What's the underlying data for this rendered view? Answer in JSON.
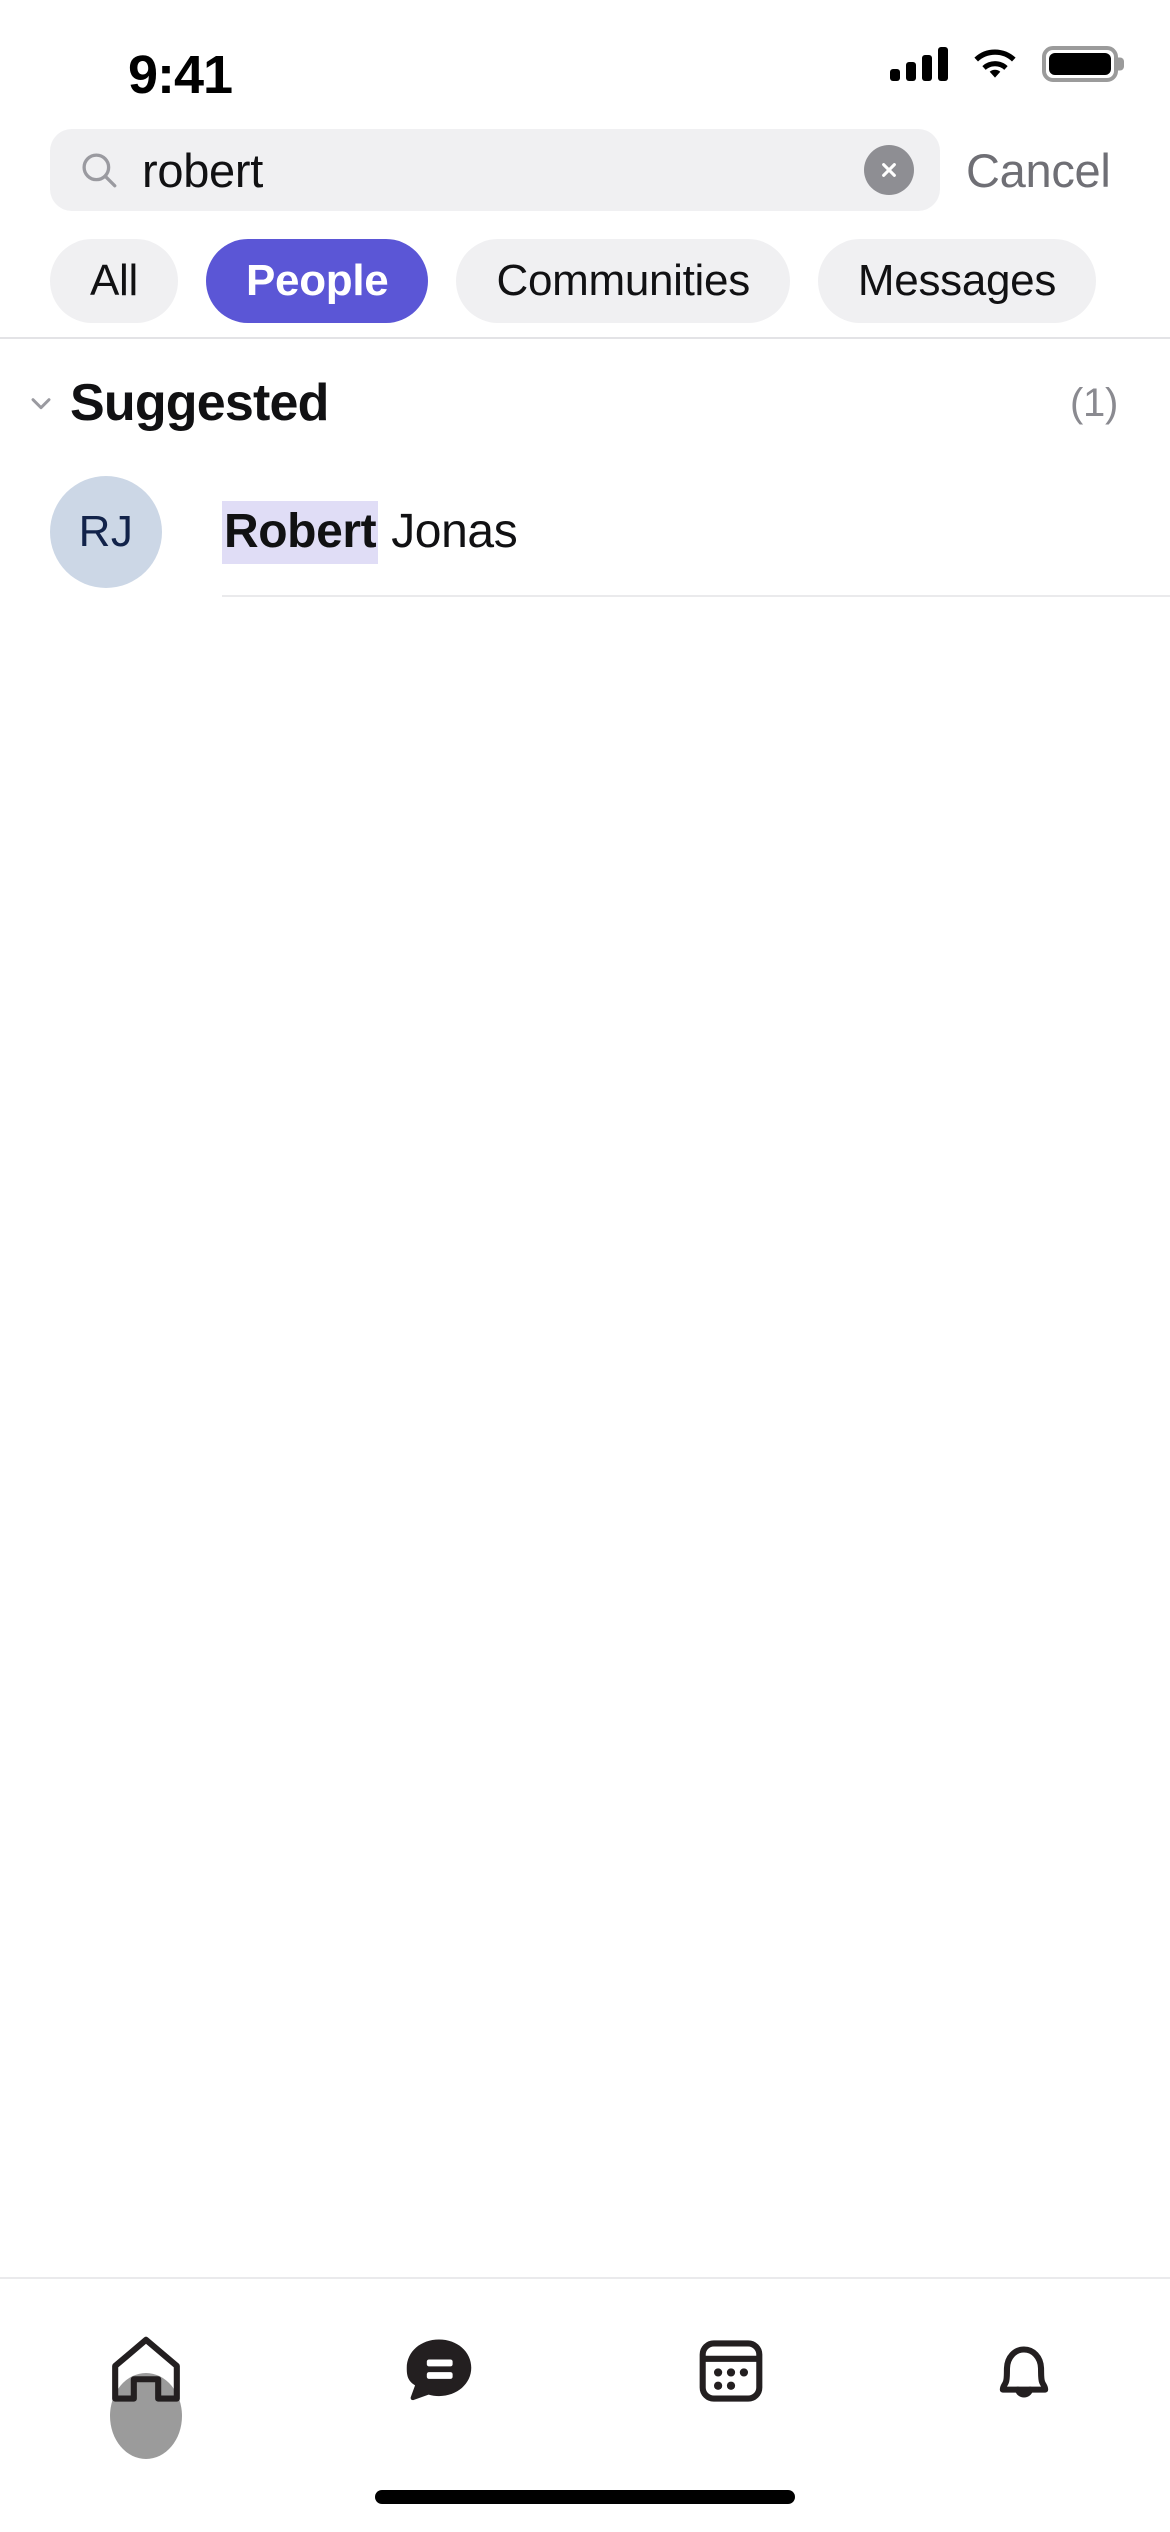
{
  "status_bar": {
    "time": "9:41",
    "cellular_icon": "cellular-signal-icon",
    "wifi_icon": "wifi-icon",
    "battery_icon": "battery-full-icon"
  },
  "search": {
    "icon": "search-icon",
    "value": "robert",
    "placeholder": "Search",
    "clear_icon": "clear-circle-icon",
    "cancel_label": "Cancel"
  },
  "filters": {
    "chips": [
      {
        "label": "All",
        "selected": false
      },
      {
        "label": "People",
        "selected": true
      },
      {
        "label": "Communities",
        "selected": false
      },
      {
        "label": "Messages",
        "selected": false
      }
    ],
    "selected_color": "#5b56d6",
    "unselected_color": "#f0f0f2"
  },
  "results": {
    "section": {
      "title": "Suggested",
      "count": "(1)",
      "collapse_icon": "chevron-down-icon"
    },
    "items": [
      {
        "initials": "RJ",
        "name_match": "Robert",
        "name_rest": " Jonas",
        "avatar_bg": "#ccd7e6",
        "avatar_fg": "#12234a",
        "highlight_bg": "#e0ddf6"
      }
    ]
  },
  "tab_bar": {
    "tabs": [
      {
        "name": "home",
        "icon": "home-icon",
        "active": false
      },
      {
        "name": "chat",
        "icon": "chat-bubble-icon",
        "active": true
      },
      {
        "name": "calendar",
        "icon": "calendar-icon",
        "active": false
      },
      {
        "name": "notifications",
        "icon": "bell-icon",
        "active": false
      }
    ],
    "home_indicator": "home-indicator"
  }
}
